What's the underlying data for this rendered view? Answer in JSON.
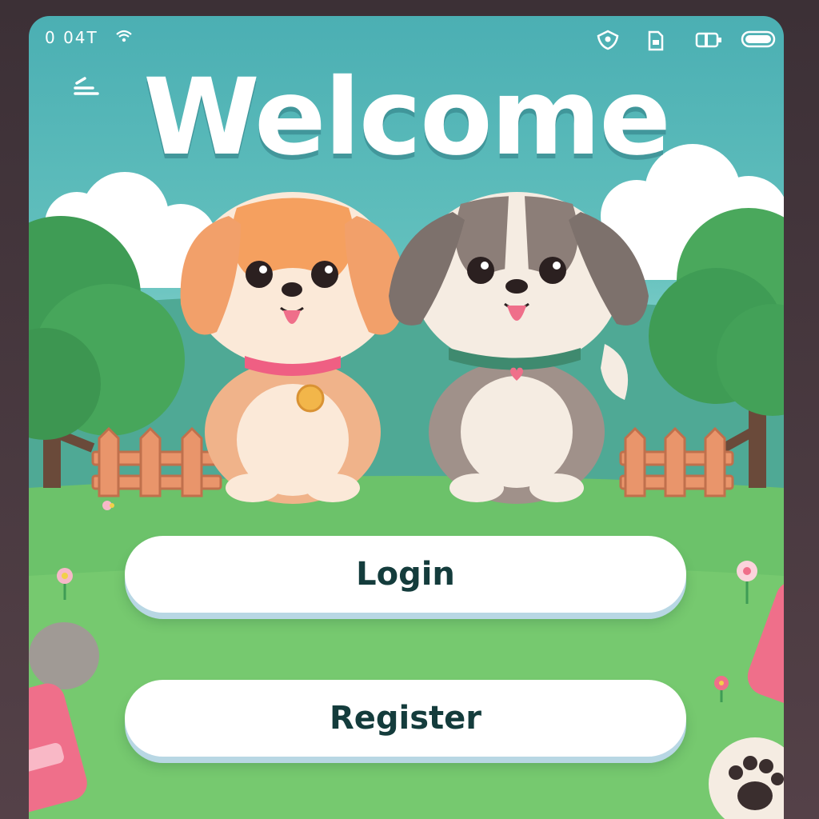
{
  "status_bar": {
    "time": "0 04T",
    "icons": [
      "wifi-icon",
      "location-shield-icon",
      "sim-card-icon",
      "battery-saver-icon",
      "battery-icon"
    ]
  },
  "header": {
    "menu_icon": "menu-icon",
    "title": "Welcome"
  },
  "scene": {
    "characters": [
      "orange-puppy",
      "grey-puppy"
    ],
    "decor": [
      "trees",
      "clouds",
      "wooden-fence",
      "flowers",
      "rock",
      "paw-print-icon"
    ]
  },
  "actions": {
    "login_label": "Login",
    "register_label": "Register"
  },
  "colors": {
    "sky": "#4bafb3",
    "grass": "#6cc26a",
    "button": "#ffffff",
    "button_text": "#143c3c",
    "accent_pink": "#ef6f8a"
  }
}
